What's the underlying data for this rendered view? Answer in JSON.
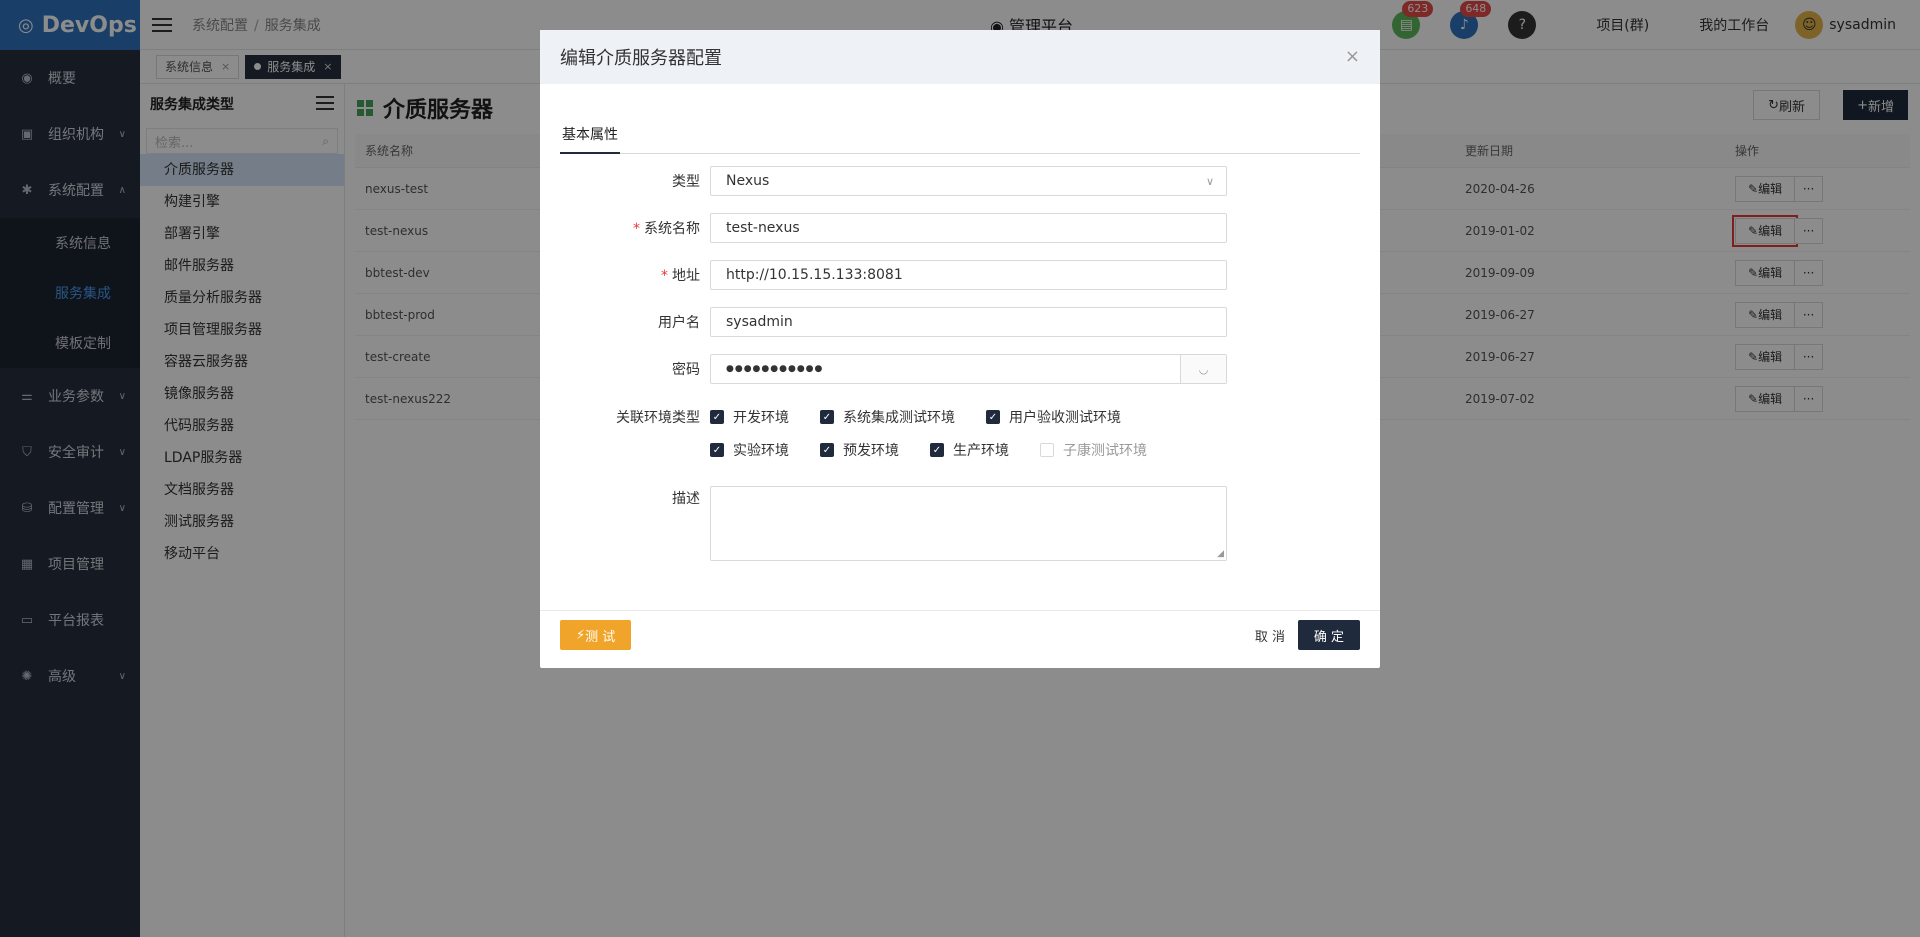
{
  "app": {
    "logo": "DevOps",
    "logo_icon": "devops-logo-icon"
  },
  "leftnav": {
    "items": [
      {
        "label": "概要",
        "icon": "dashboard-icon"
      },
      {
        "label": "组织机构",
        "icon": "lock-icon"
      },
      {
        "label": "系统配置",
        "icon": "gear-icon"
      },
      {
        "label": "业务参数",
        "icon": "sliders-icon"
      },
      {
        "label": "安全审计",
        "icon": "shield-icon"
      },
      {
        "label": "配置管理",
        "icon": "database-icon"
      },
      {
        "label": "项目管理",
        "icon": "grid-icon"
      },
      {
        "label": "平台报表",
        "icon": "monitor-icon"
      },
      {
        "label": "高级",
        "icon": "advanced-icon"
      }
    ],
    "subitems": [
      "系统信息",
      "服务集成",
      "模板定制"
    ]
  },
  "header": {
    "breadcrumb": [
      "系统配置",
      "服务集成"
    ],
    "platform": "管理平台",
    "badges": {
      "docs": "623",
      "notifications": "648"
    },
    "links": [
      "项目(群)",
      "我的工作台"
    ],
    "user": "sysadmin"
  },
  "tabs": [
    {
      "label": "系统信息"
    },
    {
      "label": "服务集成"
    }
  ],
  "typepanel": {
    "title": "服务集成类型",
    "search_placeholder": "检索...",
    "items": [
      "介质服务器",
      "构建引擎",
      "部署引擎",
      "邮件服务器",
      "质量分析服务器",
      "项目管理服务器",
      "容器云服务器",
      "镜像服务器",
      "代码服务器",
      "LDAP服务器",
      "文档服务器",
      "测试服务器",
      "移动平台"
    ]
  },
  "main": {
    "title": "介质服务器",
    "refresh": "刷新",
    "add": "新增",
    "columns": {
      "name": "系统名称",
      "date": "更新日期",
      "op": "操作"
    },
    "rows": [
      {
        "name": "nexus-test",
        "date": "2020-04-26"
      },
      {
        "name": "test-nexus",
        "date": "2019-01-02"
      },
      {
        "name": "bbtest-dev",
        "date": "2019-09-09"
      },
      {
        "name": "bbtest-prod",
        "date": "2019-06-27"
      },
      {
        "name": "test-create",
        "date": "2019-06-27"
      },
      {
        "name": "test-nexus222",
        "date": "2019-07-02"
      }
    ],
    "edit_label": "编辑",
    "more_label": "···"
  },
  "modal": {
    "title": "编辑介质服务器配置",
    "tab": "基本属性",
    "fields": {
      "type": {
        "label": "类型",
        "value": "Nexus"
      },
      "name": {
        "label": "系统名称",
        "value": "test-nexus"
      },
      "address": {
        "label": "地址",
        "value": "http://10.15.15.133:8081"
      },
      "username": {
        "label": "用户名",
        "value": "sysadmin"
      },
      "password": {
        "label": "密码",
        "value": "●●●●●●●●●●●"
      },
      "env": {
        "label": "关联环境类型"
      },
      "desc": {
        "label": "描述",
        "value": ""
      }
    },
    "envs": [
      {
        "label": "开发环境",
        "checked": true
      },
      {
        "label": "系统集成测试环境",
        "checked": true
      },
      {
        "label": "用户验收测试环境",
        "checked": true
      },
      {
        "label": "实验环境",
        "checked": true
      },
      {
        "label": "预发环境",
        "checked": true
      },
      {
        "label": "生产环境",
        "checked": true
      },
      {
        "label": "子康测试环境",
        "checked": false
      }
    ],
    "test": "测 试",
    "cancel": "取 消",
    "ok": "确 定"
  }
}
